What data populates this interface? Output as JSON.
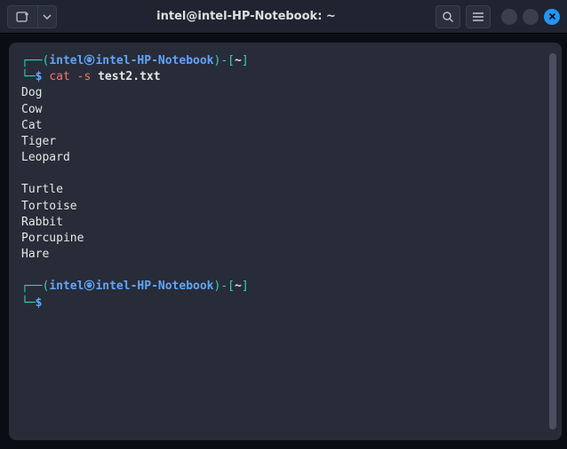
{
  "titlebar": {
    "title": "intel@intel-HP-Notebook: ~"
  },
  "prompt1": {
    "open_paren": "(",
    "user": "intel",
    "host": "intel-HP-Notebook",
    "close_paren": ")",
    "dash": "-",
    "bracket_open": "[",
    "path": "~",
    "bracket_close": "]",
    "symbol": "$",
    "command": "cat -s",
    "arg": "test2.txt"
  },
  "output": {
    "lines": [
      "Dog",
      "Cow",
      "Cat",
      "Tiger",
      "Leopard",
      "",
      "Turtle",
      "Tortoise",
      "Rabbit",
      "Porcupine",
      "Hare"
    ]
  },
  "prompt2": {
    "open_paren": "(",
    "user": "intel",
    "host": "intel-HP-Notebook",
    "close_paren": ")",
    "dash": "-",
    "bracket_open": "[",
    "path": "~",
    "bracket_close": "]",
    "symbol": "$"
  }
}
